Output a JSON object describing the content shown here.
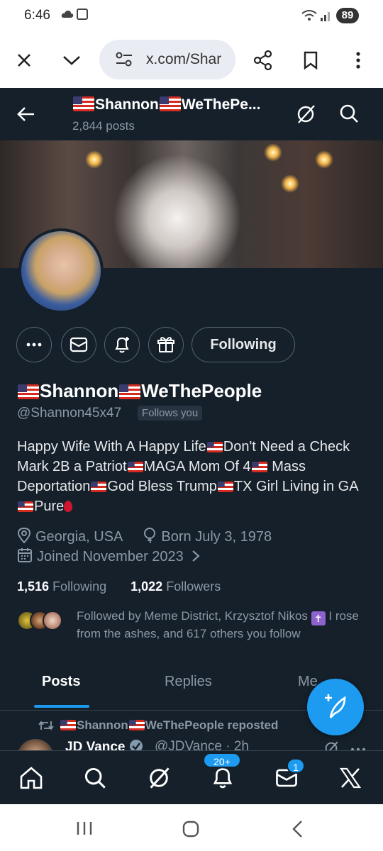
{
  "status_bar": {
    "time": "6:46",
    "battery": "89"
  },
  "browser": {
    "url": "x.com/Shar"
  },
  "header": {
    "name_a": "Shannon",
    "name_b": "WeThePe...",
    "post_count": "2,844 posts"
  },
  "actions": {
    "following_label": "Following"
  },
  "profile": {
    "name_a": "Shannon",
    "name_b": "WeThePeople",
    "handle": "@Shannon45x47",
    "follows_you": "Follows you",
    "bio": {
      "p1": "Happy Wife With A Happy Life",
      "p2": "Don't Need a Check Mark 2B a Patriot",
      "p3": "MAGA Mom Of 4",
      "p4": "Mass Deportation",
      "p5": "God Bless Trump",
      "p6": "TX Girl Living in GA",
      "p7": "Pure"
    },
    "location": "Georgia, USA",
    "born": "Born July 3, 1978",
    "joined": "Joined November 2023",
    "following_count": "1,516",
    "following_label": "Following",
    "followers_count": "1,022",
    "followers_label": "Followers",
    "followed_by_a": "Followed by Meme District, Krzysztof Nikos",
    "followed_by_b": "I rose from the ashes, and 617 others you follow"
  },
  "tabs": [
    {
      "label": "Posts"
    },
    {
      "label": "Replies"
    },
    {
      "label": "Me"
    }
  ],
  "feed": {
    "repost_name_a": "Shannon",
    "repost_name_b": "WeThePeople reposted",
    "tweet_name": "JD Vance",
    "tweet_handle": "@JDVance · 2h"
  },
  "bottom_nav": {
    "notifications_badge": "20+",
    "messages_badge": "1"
  },
  "colors": {
    "background": "#15202b",
    "accent": "#1d9bf0",
    "muted": "#8b98a5"
  },
  "icons": [
    "close-icon",
    "chevron-down-icon",
    "site-settings-icon",
    "share-icon",
    "bookmark-icon",
    "more-vert-icon",
    "back-arrow-icon",
    "grok-icon",
    "search-icon",
    "more-icon",
    "mail-icon",
    "bell-plus-icon",
    "gift-icon",
    "location-icon",
    "balloon-icon",
    "calendar-icon",
    "chevron-right-icon",
    "feather-plus-icon",
    "retweet-icon",
    "verified-icon",
    "home-icon",
    "bell-icon",
    "x-logo-icon"
  ]
}
